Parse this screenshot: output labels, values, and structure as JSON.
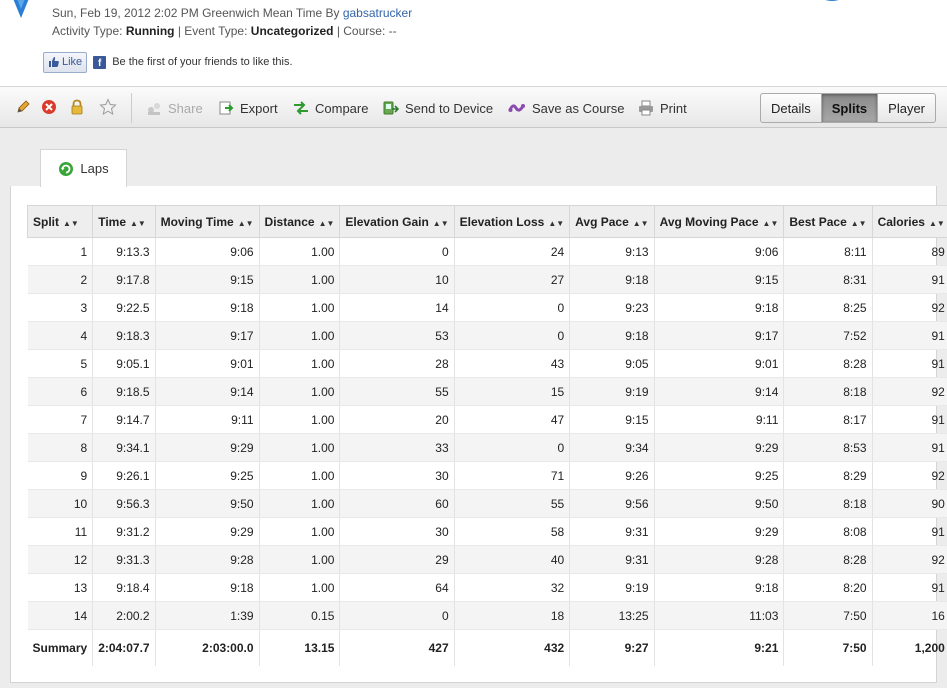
{
  "header": {
    "date_text": "Sun, Feb 19, 2012 2:02 PM Greenwich Mean Time By",
    "author": "gabsatrucker",
    "activity_type_label": "Activity Type:",
    "activity_type": "Running",
    "event_type_label": "| Event Type:",
    "event_type": "Uncategorized",
    "course_label": "| Course:",
    "course": "--"
  },
  "social": {
    "like_label": "Like",
    "like_text": "Be the first of your friends to like this."
  },
  "toolbar": {
    "share": "Share",
    "export": "Export",
    "compare": "Compare",
    "send_to_device": "Send to Device",
    "save_as_course": "Save as Course",
    "print": "Print",
    "views": [
      "Details",
      "Splits",
      "Player"
    ],
    "active_view": "Splits"
  },
  "tabs": {
    "laps": "Laps"
  },
  "table": {
    "columns": [
      "Split",
      "Time",
      "Moving Time",
      "Distance",
      "Elevation Gain",
      "Elevation Loss",
      "Avg Pace",
      "Avg Moving Pace",
      "Best Pace",
      "Calories"
    ],
    "rows": [
      [
        "1",
        "9:13.3",
        "9:06",
        "1.00",
        "0",
        "24",
        "9:13",
        "9:06",
        "8:11",
        "89"
      ],
      [
        "2",
        "9:17.8",
        "9:15",
        "1.00",
        "10",
        "27",
        "9:18",
        "9:15",
        "8:31",
        "91"
      ],
      [
        "3",
        "9:22.5",
        "9:18",
        "1.00",
        "14",
        "0",
        "9:23",
        "9:18",
        "8:25",
        "92"
      ],
      [
        "4",
        "9:18.3",
        "9:17",
        "1.00",
        "53",
        "0",
        "9:18",
        "9:17",
        "7:52",
        "91"
      ],
      [
        "5",
        "9:05.1",
        "9:01",
        "1.00",
        "28",
        "43",
        "9:05",
        "9:01",
        "8:28",
        "91"
      ],
      [
        "6",
        "9:18.5",
        "9:14",
        "1.00",
        "55",
        "15",
        "9:19",
        "9:14",
        "8:18",
        "92"
      ],
      [
        "7",
        "9:14.7",
        "9:11",
        "1.00",
        "20",
        "47",
        "9:15",
        "9:11",
        "8:17",
        "91"
      ],
      [
        "8",
        "9:34.1",
        "9:29",
        "1.00",
        "33",
        "0",
        "9:34",
        "9:29",
        "8:53",
        "91"
      ],
      [
        "9",
        "9:26.1",
        "9:25",
        "1.00",
        "30",
        "71",
        "9:26",
        "9:25",
        "8:29",
        "92"
      ],
      [
        "10",
        "9:56.3",
        "9:50",
        "1.00",
        "60",
        "55",
        "9:56",
        "9:50",
        "8:18",
        "90"
      ],
      [
        "11",
        "9:31.2",
        "9:29",
        "1.00",
        "30",
        "58",
        "9:31",
        "9:29",
        "8:08",
        "91"
      ],
      [
        "12",
        "9:31.3",
        "9:28",
        "1.00",
        "29",
        "40",
        "9:31",
        "9:28",
        "8:28",
        "92"
      ],
      [
        "13",
        "9:18.4",
        "9:18",
        "1.00",
        "64",
        "32",
        "9:19",
        "9:18",
        "8:20",
        "91"
      ],
      [
        "14",
        "2:00.2",
        "1:39",
        "0.15",
        "0",
        "18",
        "13:25",
        "11:03",
        "7:50",
        "16"
      ]
    ],
    "summary": [
      "Summary",
      "2:04:07.7",
      "2:03:00.0",
      "13.15",
      "427",
      "432",
      "9:27",
      "9:21",
      "7:50",
      "1,200"
    ]
  }
}
